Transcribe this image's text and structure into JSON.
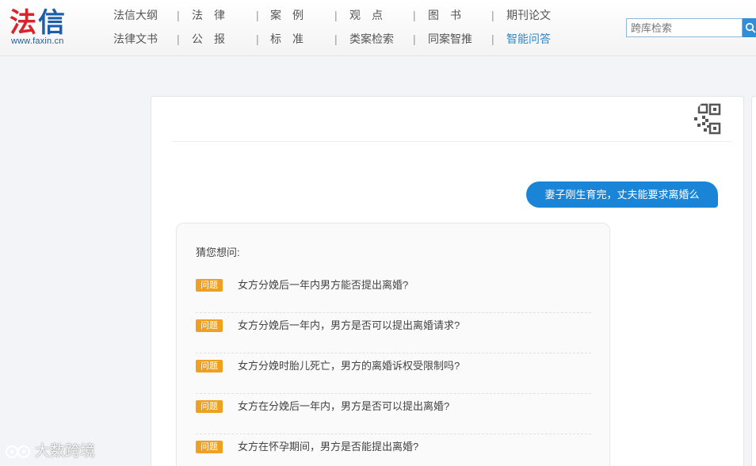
{
  "logo": {
    "char1": "法",
    "char2": "信",
    "url": "www.faxin.cn"
  },
  "nav": {
    "row1": [
      "法信大纲",
      "法　律",
      "案　例",
      "观　点",
      "图　书",
      "期刊论文"
    ],
    "row2": [
      "法律文书",
      "公　报",
      "标　准",
      "类案检索",
      "同案智推",
      "智能问答"
    ],
    "separator": "|",
    "active": "智能问答"
  },
  "search": {
    "placeholder": "跨库检索",
    "value": "跨库检索"
  },
  "chat": {
    "user_message": "妻子刚生育完，丈夫能要求离婚么",
    "suggest_title": "猜您想问:",
    "badge_label": "问题",
    "questions": [
      "女方分娩后一年内男方能否提出离婚?",
      "女方分娩后一年内，男方是否可以提出离婚请求?",
      "女方分娩时胎儿死亡，男方的离婚诉权受限制吗?",
      "女方在分娩后一年内，男方是否可以提出离婚?",
      "女方在怀孕期间，男方是否能提出离婚?"
    ]
  },
  "watermark": {
    "text": "大数跨境"
  },
  "colors": {
    "accent": "#1a85d6",
    "badge": "#f0a020",
    "brand_red": "#d7252b",
    "brand_blue": "#1c5fa8"
  },
  "icons": {
    "search": "search-icon",
    "qr": "qr-code-icon"
  }
}
